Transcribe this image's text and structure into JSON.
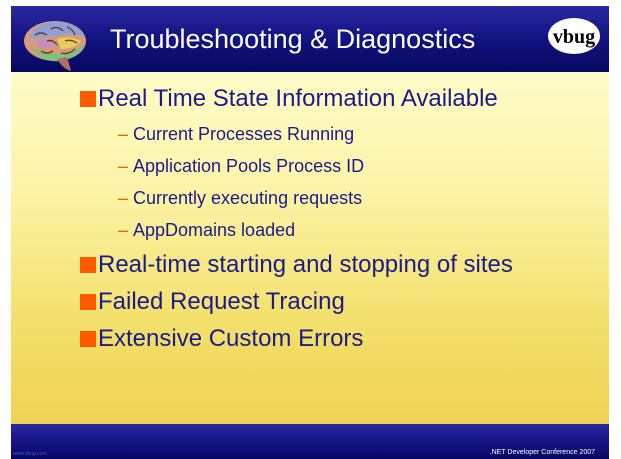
{
  "slide": {
    "title": "Troubleshooting & Diagnostics",
    "logo_text": "vbug",
    "bullets": [
      {
        "text": "Real Time State Information Available",
        "sub": [
          "Current Processes Running",
          "Application Pools Process ID",
          "Currently executing requests",
          "AppDomains loaded"
        ]
      },
      {
        "text": "Real-time starting and stopping of sites"
      },
      {
        "text": "Failed Request Tracing"
      },
      {
        "text": "Extensive Custom Errors"
      }
    ],
    "sub_marker": "–",
    "footer_left": "www.vbug.com",
    "footer_right": ".NET Developer Conference 2007"
  },
  "colors": {
    "header": "#141485",
    "background": "#ffffcc",
    "bullet": "#ff5a00",
    "text": "#1b1b8c"
  },
  "icons": [
    "brain-icon",
    "vbug-logo"
  ]
}
